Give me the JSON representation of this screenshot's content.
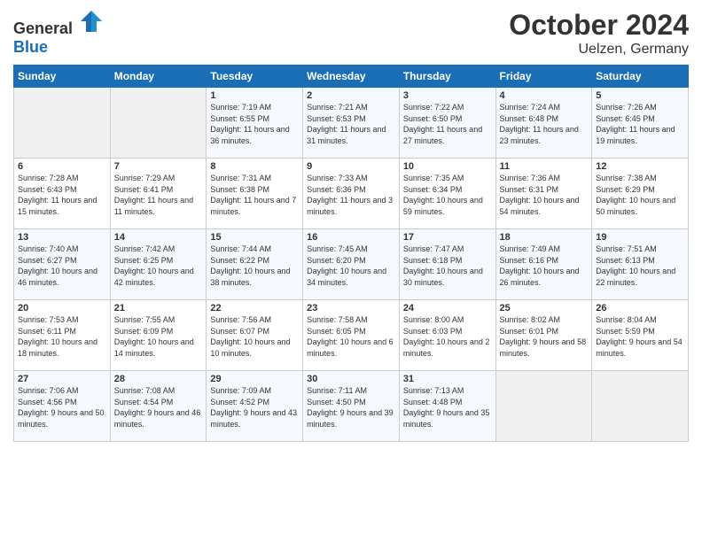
{
  "header": {
    "logo_general": "General",
    "logo_blue": "Blue",
    "month": "October 2024",
    "location": "Uelzen, Germany"
  },
  "days_of_week": [
    "Sunday",
    "Monday",
    "Tuesday",
    "Wednesday",
    "Thursday",
    "Friday",
    "Saturday"
  ],
  "weeks": [
    [
      {
        "day": "",
        "info": ""
      },
      {
        "day": "",
        "info": ""
      },
      {
        "day": "1",
        "info": "Sunrise: 7:19 AM\nSunset: 6:55 PM\nDaylight: 11 hours and 36 minutes."
      },
      {
        "day": "2",
        "info": "Sunrise: 7:21 AM\nSunset: 6:53 PM\nDaylight: 11 hours and 31 minutes."
      },
      {
        "day": "3",
        "info": "Sunrise: 7:22 AM\nSunset: 6:50 PM\nDaylight: 11 hours and 27 minutes."
      },
      {
        "day": "4",
        "info": "Sunrise: 7:24 AM\nSunset: 6:48 PM\nDaylight: 11 hours and 23 minutes."
      },
      {
        "day": "5",
        "info": "Sunrise: 7:26 AM\nSunset: 6:45 PM\nDaylight: 11 hours and 19 minutes."
      }
    ],
    [
      {
        "day": "6",
        "info": "Sunrise: 7:28 AM\nSunset: 6:43 PM\nDaylight: 11 hours and 15 minutes."
      },
      {
        "day": "7",
        "info": "Sunrise: 7:29 AM\nSunset: 6:41 PM\nDaylight: 11 hours and 11 minutes."
      },
      {
        "day": "8",
        "info": "Sunrise: 7:31 AM\nSunset: 6:38 PM\nDaylight: 11 hours and 7 minutes."
      },
      {
        "day": "9",
        "info": "Sunrise: 7:33 AM\nSunset: 6:36 PM\nDaylight: 11 hours and 3 minutes."
      },
      {
        "day": "10",
        "info": "Sunrise: 7:35 AM\nSunset: 6:34 PM\nDaylight: 10 hours and 59 minutes."
      },
      {
        "day": "11",
        "info": "Sunrise: 7:36 AM\nSunset: 6:31 PM\nDaylight: 10 hours and 54 minutes."
      },
      {
        "day": "12",
        "info": "Sunrise: 7:38 AM\nSunset: 6:29 PM\nDaylight: 10 hours and 50 minutes."
      }
    ],
    [
      {
        "day": "13",
        "info": "Sunrise: 7:40 AM\nSunset: 6:27 PM\nDaylight: 10 hours and 46 minutes."
      },
      {
        "day": "14",
        "info": "Sunrise: 7:42 AM\nSunset: 6:25 PM\nDaylight: 10 hours and 42 minutes."
      },
      {
        "day": "15",
        "info": "Sunrise: 7:44 AM\nSunset: 6:22 PM\nDaylight: 10 hours and 38 minutes."
      },
      {
        "day": "16",
        "info": "Sunrise: 7:45 AM\nSunset: 6:20 PM\nDaylight: 10 hours and 34 minutes."
      },
      {
        "day": "17",
        "info": "Sunrise: 7:47 AM\nSunset: 6:18 PM\nDaylight: 10 hours and 30 minutes."
      },
      {
        "day": "18",
        "info": "Sunrise: 7:49 AM\nSunset: 6:16 PM\nDaylight: 10 hours and 26 minutes."
      },
      {
        "day": "19",
        "info": "Sunrise: 7:51 AM\nSunset: 6:13 PM\nDaylight: 10 hours and 22 minutes."
      }
    ],
    [
      {
        "day": "20",
        "info": "Sunrise: 7:53 AM\nSunset: 6:11 PM\nDaylight: 10 hours and 18 minutes."
      },
      {
        "day": "21",
        "info": "Sunrise: 7:55 AM\nSunset: 6:09 PM\nDaylight: 10 hours and 14 minutes."
      },
      {
        "day": "22",
        "info": "Sunrise: 7:56 AM\nSunset: 6:07 PM\nDaylight: 10 hours and 10 minutes."
      },
      {
        "day": "23",
        "info": "Sunrise: 7:58 AM\nSunset: 6:05 PM\nDaylight: 10 hours and 6 minutes."
      },
      {
        "day": "24",
        "info": "Sunrise: 8:00 AM\nSunset: 6:03 PM\nDaylight: 10 hours and 2 minutes."
      },
      {
        "day": "25",
        "info": "Sunrise: 8:02 AM\nSunset: 6:01 PM\nDaylight: 9 hours and 58 minutes."
      },
      {
        "day": "26",
        "info": "Sunrise: 8:04 AM\nSunset: 5:59 PM\nDaylight: 9 hours and 54 minutes."
      }
    ],
    [
      {
        "day": "27",
        "info": "Sunrise: 7:06 AM\nSunset: 4:56 PM\nDaylight: 9 hours and 50 minutes."
      },
      {
        "day": "28",
        "info": "Sunrise: 7:08 AM\nSunset: 4:54 PM\nDaylight: 9 hours and 46 minutes."
      },
      {
        "day": "29",
        "info": "Sunrise: 7:09 AM\nSunset: 4:52 PM\nDaylight: 9 hours and 43 minutes."
      },
      {
        "day": "30",
        "info": "Sunrise: 7:11 AM\nSunset: 4:50 PM\nDaylight: 9 hours and 39 minutes."
      },
      {
        "day": "31",
        "info": "Sunrise: 7:13 AM\nSunset: 4:48 PM\nDaylight: 9 hours and 35 minutes."
      },
      {
        "day": "",
        "info": ""
      },
      {
        "day": "",
        "info": ""
      }
    ]
  ]
}
